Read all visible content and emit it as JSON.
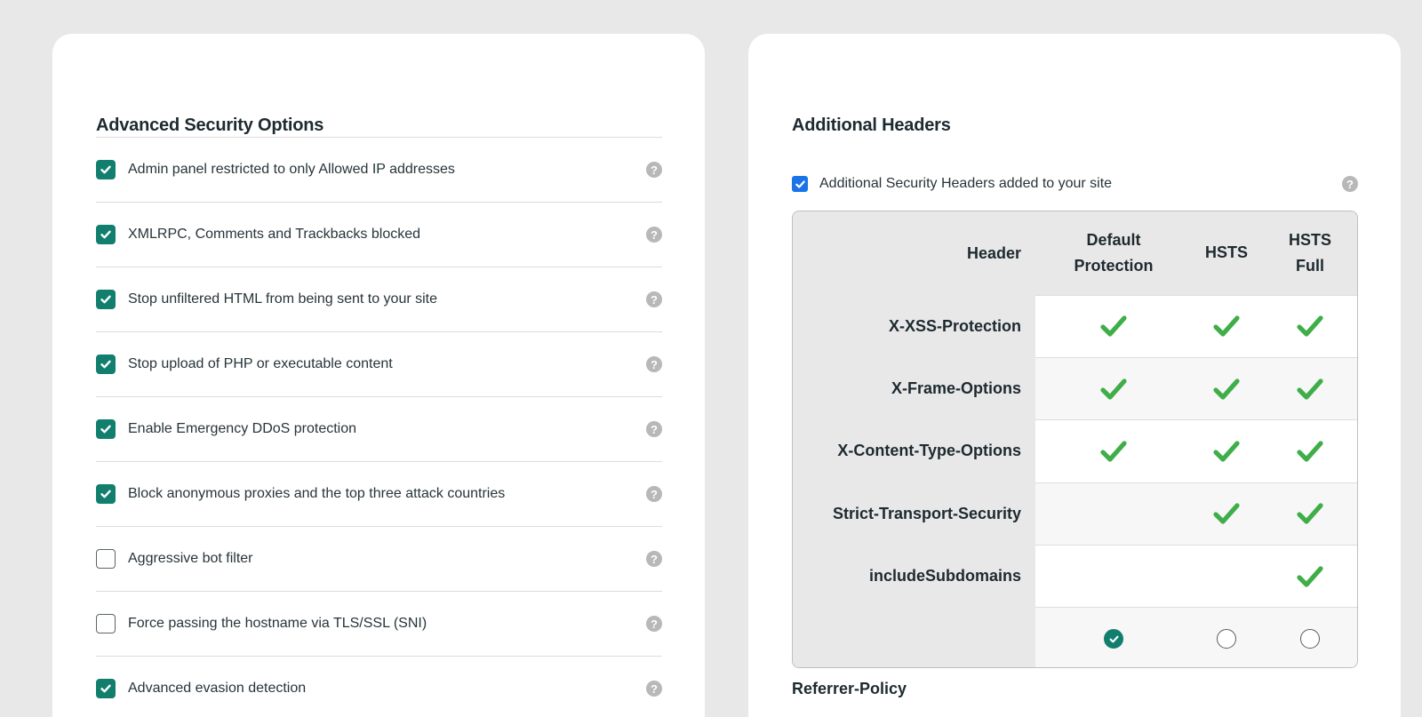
{
  "left_card": {
    "title": "Advanced Security Options",
    "options": [
      {
        "label": "Admin panel restricted to only Allowed IP addresses",
        "checked": true
      },
      {
        "label": "XMLRPC, Comments and Trackbacks blocked",
        "checked": true
      },
      {
        "label": "Stop unfiltered HTML from being sent to your site",
        "checked": true
      },
      {
        "label": "Stop upload of PHP or executable content",
        "checked": true
      },
      {
        "label": "Enable Emergency DDoS protection",
        "checked": true
      },
      {
        "label": "Block anonymous proxies and the top three attack countries",
        "checked": true
      },
      {
        "label": "Aggressive bot filter",
        "checked": false
      },
      {
        "label": "Force passing the hostname via TLS/SSL (SNI)",
        "checked": false
      },
      {
        "label": "Advanced evasion detection",
        "checked": true
      }
    ],
    "help_glyph": "?"
  },
  "right_card": {
    "title": "Additional Headers",
    "master_checkbox": {
      "label": "Additional Security Headers added to your site",
      "checked": true
    },
    "help_glyph": "?",
    "table": {
      "columns": {
        "header": "Header",
        "default_line1": "Default",
        "default_line2": "Protection",
        "hsts": "HSTS",
        "full_line1": "HSTS",
        "full_line2": "Full"
      },
      "rows": [
        {
          "name": "X-XSS-Protection",
          "default": true,
          "hsts": true,
          "full": true
        },
        {
          "name": "X-Frame-Options",
          "default": true,
          "hsts": true,
          "full": true
        },
        {
          "name": "X-Content-Type-Options",
          "default": true,
          "hsts": true,
          "full": true
        },
        {
          "name": "Strict-Transport-Security",
          "default": false,
          "hsts": true,
          "full": true
        },
        {
          "name": "includeSubdomains",
          "default": false,
          "hsts": false,
          "full": true
        }
      ],
      "selected_profile": "default"
    },
    "next_section_title": "Referrer-Policy"
  },
  "colors": {
    "page_bg": "#e9e8e9",
    "card_bg": "#ffffff",
    "teal_check": "#127f6e",
    "green_tick": "#3fae49",
    "blue_check": "#1a73e8",
    "help_icon": "#b8b8b8"
  },
  "icons": [
    "check-icon",
    "help-icon",
    "green-check-icon",
    "radio-icon"
  ]
}
